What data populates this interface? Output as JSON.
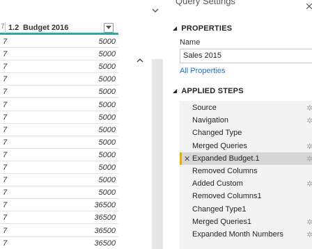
{
  "grid": {
    "prev_col_marker": "7",
    "header": {
      "type_label": "1.2",
      "column_name": "Budget 2016"
    },
    "rows": [
      {
        "prev": "7",
        "value": "5000"
      },
      {
        "prev": "7",
        "value": "5000"
      },
      {
        "prev": "7",
        "value": "5000"
      },
      {
        "prev": "7",
        "value": "5000"
      },
      {
        "prev": "7",
        "value": "5000"
      },
      {
        "prev": "7",
        "value": "5000"
      },
      {
        "prev": "7",
        "value": "5000"
      },
      {
        "prev": "7",
        "value": "5000"
      },
      {
        "prev": "7",
        "value": "5000"
      },
      {
        "prev": "7",
        "value": "5000"
      },
      {
        "prev": "7",
        "value": "5000"
      },
      {
        "prev": "7",
        "value": "5000"
      },
      {
        "prev": "7",
        "value": "5000"
      },
      {
        "prev": "7",
        "value": "36500"
      },
      {
        "prev": "7",
        "value": "36500"
      },
      {
        "prev": "7",
        "value": "36500"
      },
      {
        "prev": "7",
        "value": "36500"
      }
    ]
  },
  "settings": {
    "title": "Query Settings",
    "properties": {
      "heading": "PROPERTIES",
      "name_label": "Name",
      "name_value": "Sales 2015",
      "all_properties": "All Properties"
    },
    "applied_steps": {
      "heading": "APPLIED STEPS",
      "steps": [
        {
          "label": "Source",
          "gear": true
        },
        {
          "label": "Navigation",
          "gear": true
        },
        {
          "label": "Changed Type",
          "gear": false
        },
        {
          "label": "Merged Queries",
          "gear": true
        },
        {
          "label": "Expanded Budget.1",
          "gear": true,
          "selected": true
        },
        {
          "label": "Removed Columns",
          "gear": false
        },
        {
          "label": "Added Custom",
          "gear": true
        },
        {
          "label": "Removed Columns1",
          "gear": false
        },
        {
          "label": "Changed Type1",
          "gear": false
        },
        {
          "label": "Merged Queries1",
          "gear": true
        },
        {
          "label": "Expanded Month Numbers",
          "gear": true
        }
      ]
    }
  },
  "icons": {
    "collapse_triangle": "collapse-triangle-icon",
    "gear": "gear-icon",
    "delete_step": "close-icon",
    "filter_dropdown": "dropdown-arrow-icon",
    "scroll_up": "chevron-up-icon",
    "panel_chevron": "chevron-down-icon"
  },
  "colors": {
    "header_underline": "#2aa7a0",
    "selected_step_marker": "#e8b100",
    "link": "#1f6fd1",
    "steps_background": "#f3f3f3",
    "selected_step_background": "#d6d6d6"
  }
}
